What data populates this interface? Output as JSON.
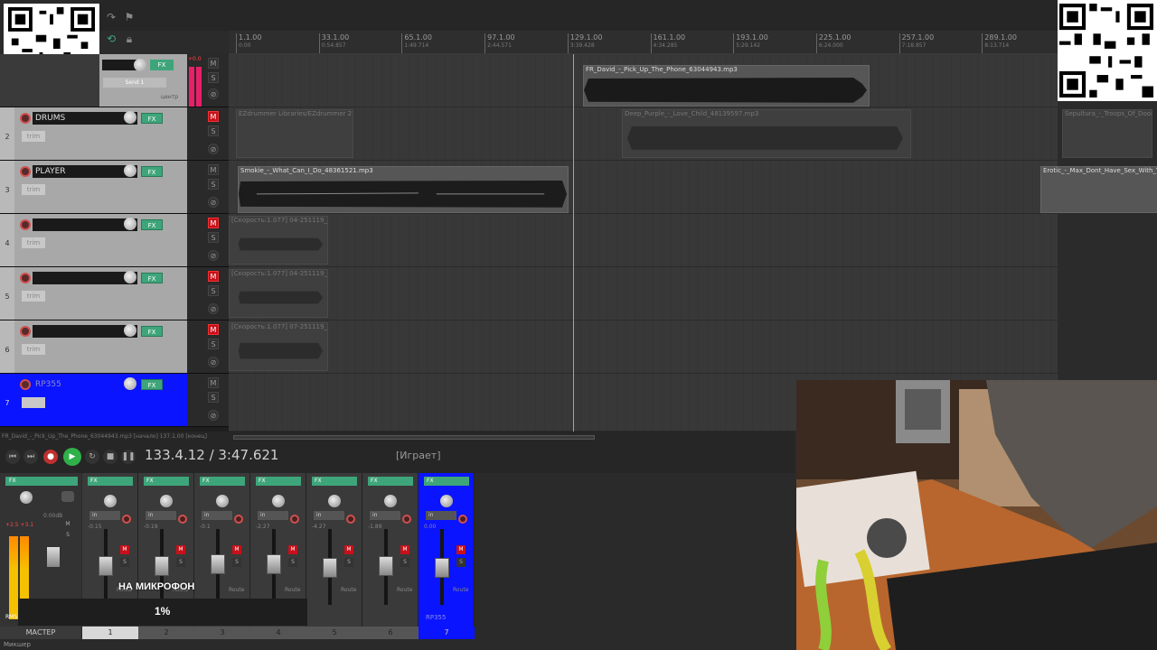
{
  "ruler": {
    "marks": [
      {
        "bar": "1.1.00",
        "time": "0:00"
      },
      {
        "bar": "33.1.00",
        "time": "0:54.857"
      },
      {
        "bar": "65.1.00",
        "time": "1:49.714"
      },
      {
        "bar": "97.1.00",
        "time": "2:44.571"
      },
      {
        "bar": "129.1.00",
        "time": "3:39.428"
      },
      {
        "bar": "161.1.00",
        "time": "4:34.285"
      },
      {
        "bar": "193.1.00",
        "time": "5:29.142"
      },
      {
        "bar": "225.1.00",
        "time": "6:24.000"
      },
      {
        "bar": "257.1.00",
        "time": "7:18.857"
      },
      {
        "bar": "289.1.00",
        "time": "8:13.714"
      }
    ]
  },
  "master_tcp": {
    "send_label": "Send 1",
    "pan_label": "центр",
    "level": "+0.0"
  },
  "tracks": [
    {
      "num": "2",
      "name": "DRUMS",
      "fx": "FX",
      "trim": "trim",
      "mute_on": true
    },
    {
      "num": "3",
      "name": "PLAYER",
      "fx": "FX",
      "trim": "trim",
      "mute_on": false
    },
    {
      "num": "4",
      "name": "",
      "fx": "FX",
      "trim": "trim",
      "mute_on": true
    },
    {
      "num": "5",
      "name": "",
      "fx": "FX",
      "trim": "trim",
      "mute_on": true
    },
    {
      "num": "6",
      "name": "",
      "fx": "FX",
      "trim": "trim",
      "mute_on": true
    },
    {
      "num": "7",
      "name": "RP355",
      "fx": "FX",
      "trim": "",
      "mute_on": false
    }
  ],
  "items": {
    "lane1_a": "FR_David_-_Pick_Up_The_Phone_63044943.mp3",
    "lane2_a": "EZdrummer Libraries/EZdrummer 2",
    "lane2_b": "Deep_Purple_-_Love_Child_48139597.mp3",
    "lane2_c": "Sepultura_-_Troops_Of_Doom",
    "lane3_a": "Smokie_-_What_Can_I_Do_48361521.mp3",
    "lane3_b": "Erotic_-_Max_Dont_Have_Sex_With_Y",
    "lane4_a": "[Скорость:1.077] 04-251119_",
    "lane5_a": "[Скорость:1.077] 04-251119_",
    "lane6_a": "[Скорость:1.077] 07-251119_"
  },
  "statusline": "FR_David_-_Pick_Up_The_Phone_63044943.mp3 [начало] 137.1.00 [конец]",
  "transport": {
    "position": "133.4.12 / 3:47.621",
    "state": "[Играет]"
  },
  "mixer": {
    "master_label": "МАСТЕР",
    "tab_label": "Микшер",
    "master_level": "0.00dB",
    "rms": "RMS",
    "strips": [
      {
        "num": "1",
        "vol": "-0.15",
        "io": "in",
        "fx": "FX",
        "route": "Route"
      },
      {
        "num": "2",
        "vol": "-0.19",
        "io": "in",
        "fx": "FX",
        "route": "Route"
      },
      {
        "num": "3",
        "vol": "-0.1",
        "io": "in",
        "fx": "FX",
        "route": "Route"
      },
      {
        "num": "4",
        "vol": "-2.27",
        "io": "in",
        "fx": "FX",
        "route": "Route"
      },
      {
        "num": "5",
        "vol": "-4.27",
        "io": "in",
        "fx": "FX",
        "route": "Route"
      },
      {
        "num": "6",
        "vol": "-1.89",
        "io": "in",
        "fx": "FX",
        "route": "Route"
      },
      {
        "num": "7",
        "vol": "0.00",
        "io": "in",
        "fx": "FX",
        "route": "Route",
        "name": "RP355"
      }
    ]
  },
  "overlay": {
    "caption": "НА МИКРОФОН",
    "progress": "1%"
  },
  "colors": {
    "selected": "#0a14ff",
    "mute": "#c8101a",
    "fx": "#3ea57a",
    "playcursor": "#d0a040"
  }
}
